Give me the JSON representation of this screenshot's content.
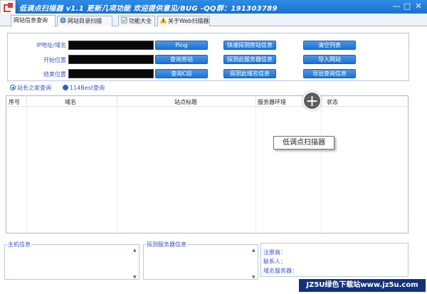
{
  "window": {
    "title": "低调点扫描器 v1.1 更新几项功能 欢迎提供意见/BUG   -QQ群：191303789",
    "controls": {
      "minimize": "—",
      "maximize": "□",
      "close": "✕"
    }
  },
  "tabs": [
    {
      "label": "网站信息查询",
      "active": true
    },
    {
      "label": "网站目录扫描",
      "active": false
    },
    {
      "label": "功能大全",
      "active": false
    },
    {
      "label": "关于Web扫描器",
      "active": false
    }
  ],
  "form": {
    "ip_label": "IP地址/域名",
    "start_label": "开始位置",
    "end_label": "结束位置",
    "ip_value": "",
    "start_value": "",
    "end_value": ""
  },
  "buttons": {
    "ping": "Ping",
    "query_side": "查询旁站",
    "query_c": "查询C段",
    "fast_side": "快速探测旁站信息",
    "probe_server": "探测此服务器信息",
    "probe_domain": "探测此域名信息",
    "clear_list": "清空列表",
    "import_site": "导入网站",
    "export_info": "导出查询信息"
  },
  "radios": [
    {
      "label": "站长之家查询",
      "selected": true
    },
    {
      "label": "114Best查询",
      "selected": false
    }
  ],
  "table": {
    "columns": [
      "序号",
      "域名",
      "站点标题",
      "服务器环境",
      "状态"
    ]
  },
  "overlay": {
    "plus": "+",
    "tooltip": "低调点扫描器"
  },
  "host_info": {
    "title": "主机信息"
  },
  "server_probe": {
    "title": "探测服务器信息"
  },
  "whois": {
    "registrant": "注册商：",
    "contact": "联系人：",
    "dns": "域名服务器："
  },
  "watermark": "JZ5U绿色下载站www.jz5u.com",
  "colors": {
    "titlebar": "#1b6fcd",
    "button": "#1d72d6",
    "label": "#3857c4"
  }
}
